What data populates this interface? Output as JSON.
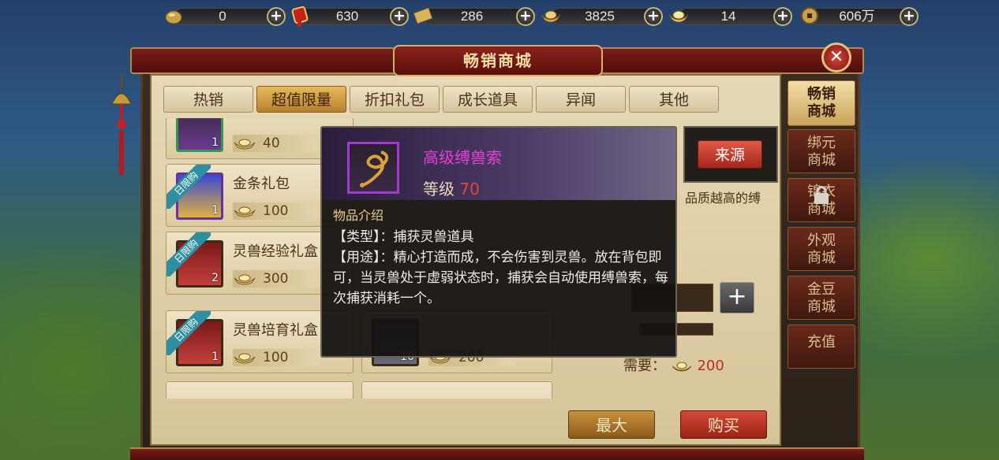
{
  "currency": [
    {
      "icon": "gold-coin-pouch-icon",
      "value": "0"
    },
    {
      "icon": "red-token-icon",
      "value": "630"
    },
    {
      "icon": "gold-card-icon",
      "value": "286"
    },
    {
      "icon": "gold-ingot-icon",
      "value": "3825"
    },
    {
      "icon": "bound-ingot-icon",
      "value": "14"
    },
    {
      "icon": "copper-coin-icon",
      "value": "606万"
    }
  ],
  "title": "畅销商城",
  "tabs": [
    "热销",
    "超值限量",
    "折扣礼包",
    "成长道具",
    "异闻",
    "其他"
  ],
  "active_tab": 1,
  "items": [
    {
      "name": "",
      "tag": "",
      "count": "1",
      "price": "40",
      "frame": "#2f9a4a"
    },
    {
      "name": "金条礼包",
      "tag": "日限购",
      "count": "1",
      "price": "100",
      "frame": "#6a2fa0"
    },
    {
      "name": "灵兽经验礼盒",
      "tag": "日限购",
      "count": "2",
      "price": "300",
      "frame": "#3b2a18"
    },
    {
      "name": "灵兽培育礼盒",
      "tag": "日限购",
      "count": "1",
      "price": "100",
      "frame": "#3b2a18"
    }
  ],
  "right_col_partial": {
    "count": "10",
    "price": "200"
  },
  "side_tabs": [
    "畅销\n商城",
    "绑元\n商城",
    "锦衣\n商城",
    "外观\n商城",
    "金豆\n商城",
    "充值"
  ],
  "tooltip": {
    "name": "高级缚兽索",
    "level_label": "等级",
    "level": "70",
    "section": "物品介绍",
    "type_line": "【类型】：捕获灵兽道具",
    "use_line": "【用途】：精心打造而成，不会伤害到灵兽。放在背包即可，当灵兽处于虚弱状态时，捕获会自动使用缚兽索，每次捕获消耗一个。"
  },
  "source_button": "来源",
  "desc_partial": "品质越高的缚",
  "need_label": "需要：",
  "need_cost": "200",
  "max_button": "最大",
  "buy_button": "购买",
  "plus": "+"
}
